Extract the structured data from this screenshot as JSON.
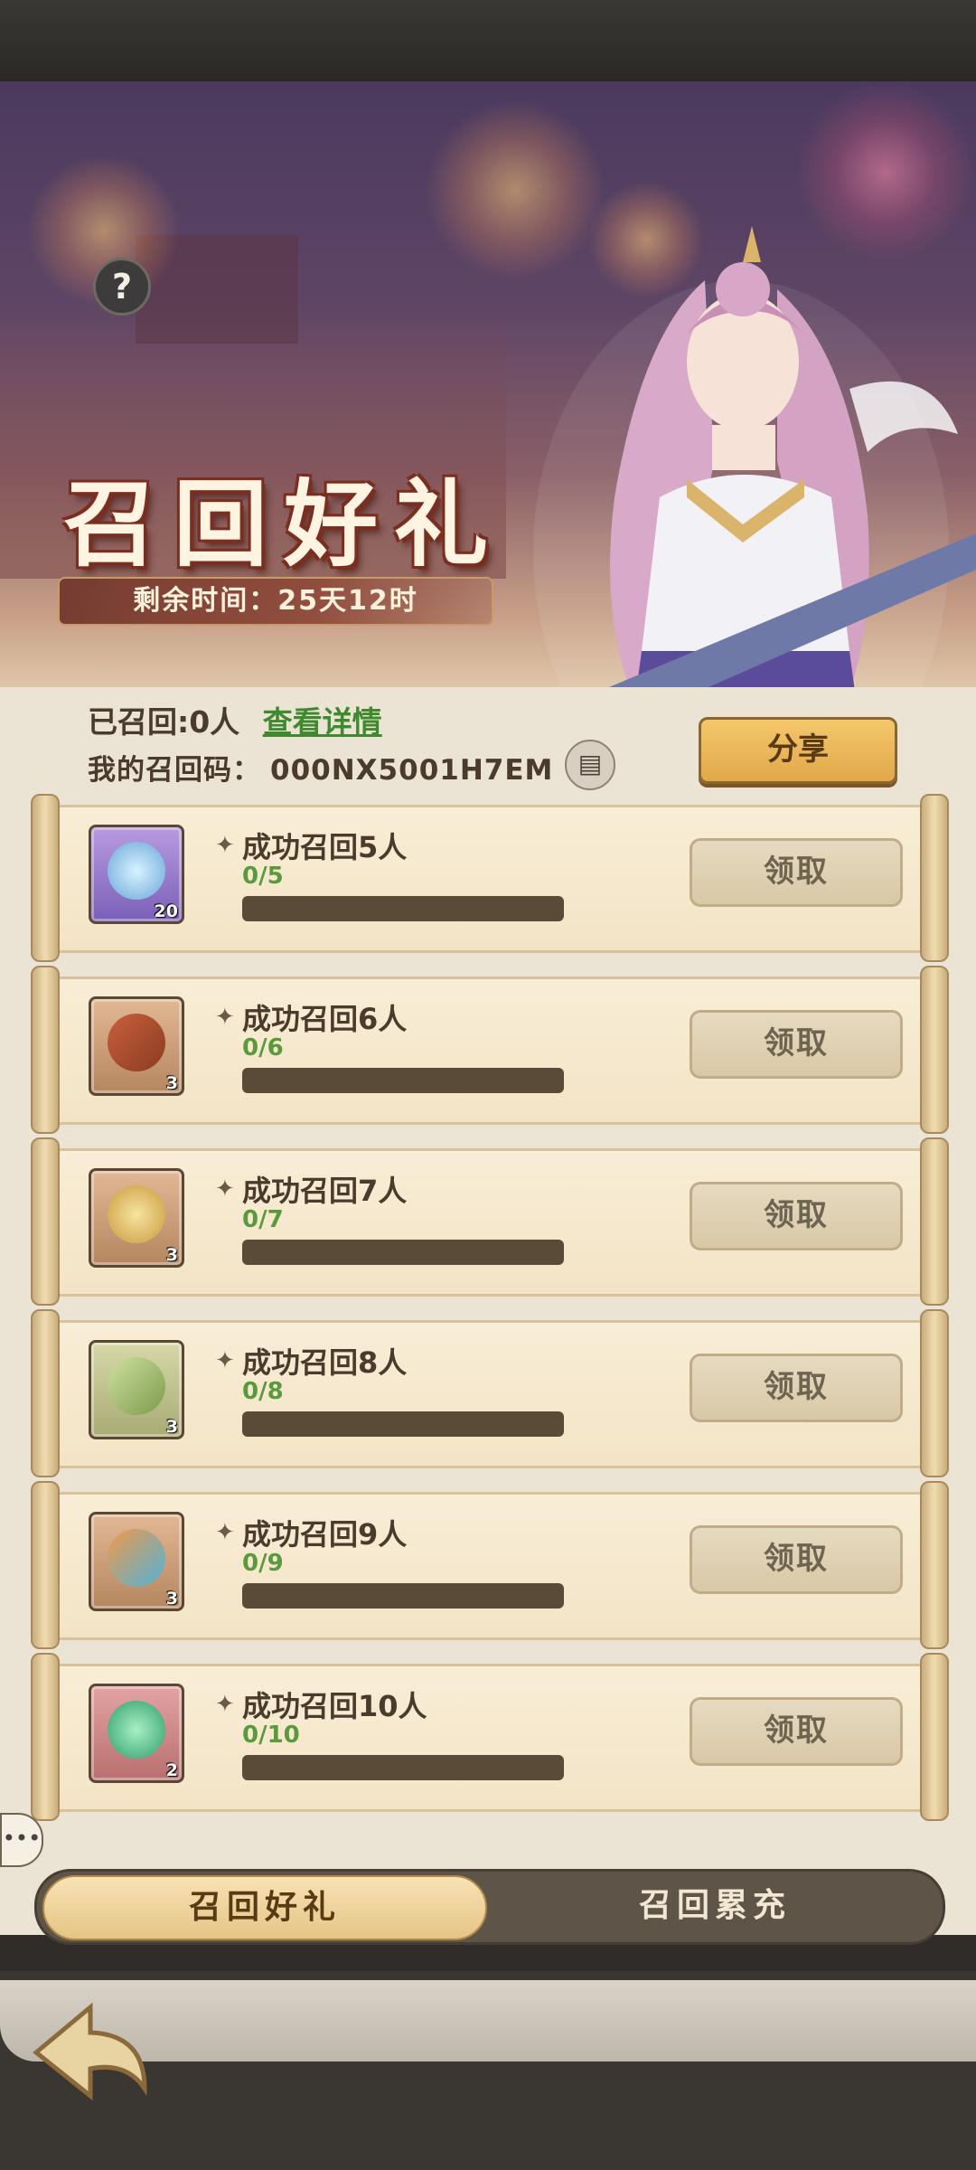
{
  "banner": {
    "help_icon": "question-icon",
    "title": "召回好礼",
    "timer_label": "剩余时间：",
    "timer_value": "25天12时"
  },
  "info": {
    "recalled_label": "已召回:",
    "recalled_value": "0人",
    "details_link": "查看详情",
    "code_label": "我的召回码：",
    "code_value": "000NX5001H7EM",
    "share_label": "分享"
  },
  "rewards": [
    {
      "condition": "成功召回5人",
      "progress": "0/5",
      "fraction": 0,
      "item": "crystal-ball",
      "qty": "20",
      "claim": "领取"
    },
    {
      "condition": "成功召回6人",
      "progress": "0/6",
      "fraction": 0,
      "item": "scroll-ticket",
      "qty": "3",
      "claim": "领取"
    },
    {
      "condition": "成功召回7人",
      "progress": "0/7",
      "fraction": 0,
      "item": "golden-key",
      "qty": "3",
      "claim": "领取"
    },
    {
      "condition": "成功召回8人",
      "progress": "0/8",
      "fraction": 0,
      "item": "green-tablet",
      "qty": "3",
      "claim": "领取"
    },
    {
      "condition": "成功召回9人",
      "progress": "0/9",
      "fraction": 0,
      "item": "elemental-stone",
      "qty": "3",
      "claim": "领取"
    },
    {
      "condition": "成功召回10人",
      "progress": "0/10",
      "fraction": 0,
      "item": "wind-orb",
      "qty": "2",
      "claim": "领取"
    }
  ],
  "tabs": [
    {
      "label": "召回好礼",
      "active": true
    },
    {
      "label": "召回累充",
      "active": false
    }
  ],
  "nav": {
    "back_icon": "back-arrow-icon",
    "chat_icon": "chat-icon"
  },
  "colors": {
    "accent": "#e0a84a",
    "progress_text": "#5a9a3c",
    "link": "#3f8a2e"
  }
}
